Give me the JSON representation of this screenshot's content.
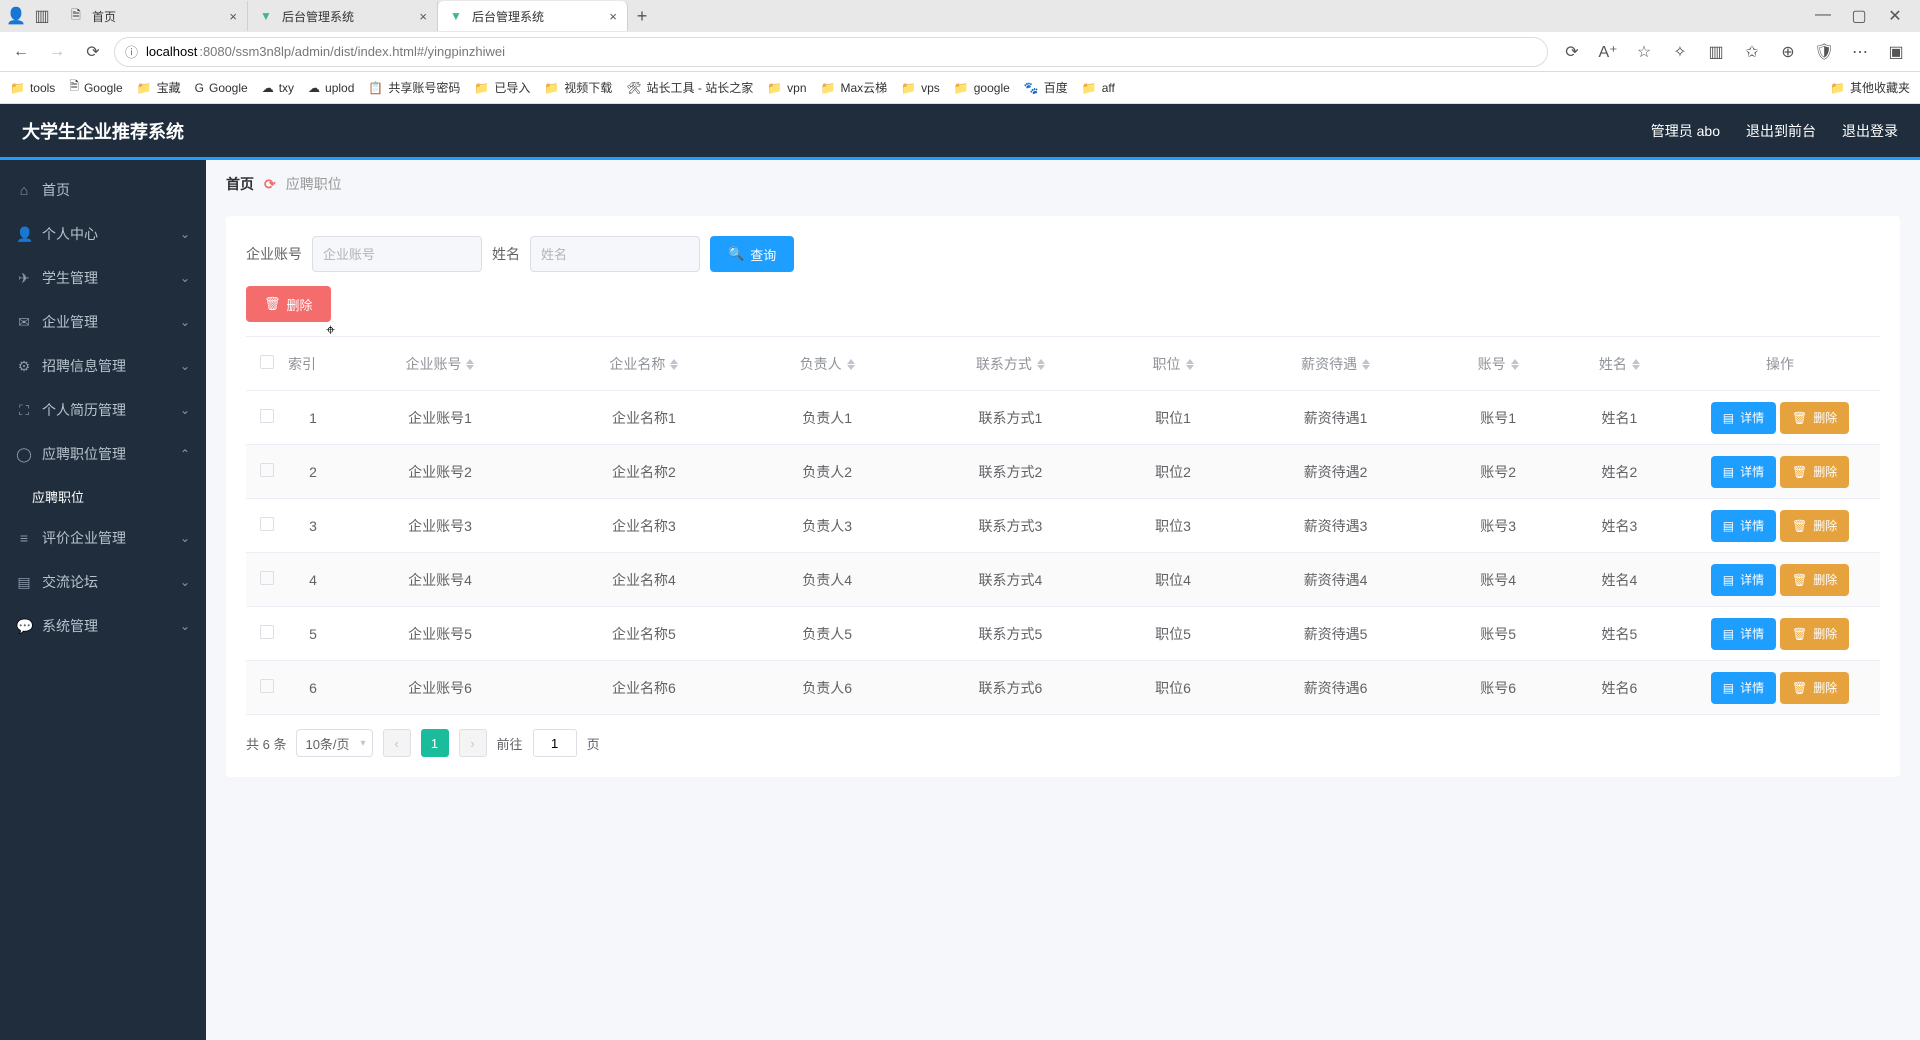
{
  "browser": {
    "tabs": [
      {
        "title": "首页"
      },
      {
        "title": "后台管理系统"
      },
      {
        "title": "后台管理系统"
      }
    ],
    "url_host": "localhost",
    "url_rest": ":8080/ssm3n8lp/admin/dist/index.html#/yingpinzhiwei",
    "bookmarks": [
      "tools",
      "Google",
      "宝藏",
      "Google",
      "txy",
      "uplod",
      "共享账号密码",
      "已导入",
      "视频下载",
      "站长工具 - 站长之家",
      "vpn",
      "Max云梯",
      "vps",
      "google",
      "百度",
      "aff"
    ],
    "other_bookmarks": "其他收藏夹"
  },
  "header": {
    "title": "大学生企业推荐系统",
    "admin_label": "管理员 abo",
    "front_label": "退出到前台",
    "logout_label": "退出登录"
  },
  "sidebar": {
    "items": [
      {
        "label": "首页",
        "icon": "home"
      },
      {
        "label": "个人中心",
        "icon": "user",
        "expandable": true
      },
      {
        "label": "学生管理",
        "icon": "plane",
        "expandable": true
      },
      {
        "label": "企业管理",
        "icon": "mail",
        "expandable": true
      },
      {
        "label": "招聘信息管理",
        "icon": "gear",
        "expandable": true
      },
      {
        "label": "个人简历管理",
        "icon": "expand",
        "expandable": true
      },
      {
        "label": "应聘职位管理",
        "icon": "circle",
        "expandable": true,
        "open": true
      },
      {
        "label": "评价企业管理",
        "icon": "bars",
        "expandable": true
      },
      {
        "label": "交流论坛",
        "icon": "chart",
        "expandable": true
      },
      {
        "label": "系统管理",
        "icon": "chat",
        "expandable": true
      }
    ],
    "submenu_active": "应聘职位"
  },
  "breadcrumb": {
    "home": "首页",
    "current": "应聘职位"
  },
  "filters": {
    "label1": "企业账号",
    "placeholder1": "企业账号",
    "label2": "姓名",
    "placeholder2": "姓名",
    "search_label": "查询",
    "delete_label": "删除"
  },
  "table": {
    "headers": [
      "索引",
      "企业账号",
      "企业名称",
      "负责人",
      "联系方式",
      "职位",
      "薪资待遇",
      "账号",
      "姓名",
      "操作"
    ],
    "action_detail": "详情",
    "action_delete": "删除",
    "rows": [
      {
        "idx": "1",
        "c1": "企业账号1",
        "c2": "企业名称1",
        "c3": "负责人1",
        "c4": "联系方式1",
        "c5": "职位1",
        "c6": "薪资待遇1",
        "c7": "账号1",
        "c8": "姓名1"
      },
      {
        "idx": "2",
        "c1": "企业账号2",
        "c2": "企业名称2",
        "c3": "负责人2",
        "c4": "联系方式2",
        "c5": "职位2",
        "c6": "薪资待遇2",
        "c7": "账号2",
        "c8": "姓名2"
      },
      {
        "idx": "3",
        "c1": "企业账号3",
        "c2": "企业名称3",
        "c3": "负责人3",
        "c4": "联系方式3",
        "c5": "职位3",
        "c6": "薪资待遇3",
        "c7": "账号3",
        "c8": "姓名3"
      },
      {
        "idx": "4",
        "c1": "企业账号4",
        "c2": "企业名称4",
        "c3": "负责人4",
        "c4": "联系方式4",
        "c5": "职位4",
        "c6": "薪资待遇4",
        "c7": "账号4",
        "c8": "姓名4"
      },
      {
        "idx": "5",
        "c1": "企业账号5",
        "c2": "企业名称5",
        "c3": "负责人5",
        "c4": "联系方式5",
        "c5": "职位5",
        "c6": "薪资待遇5",
        "c7": "账号5",
        "c8": "姓名5"
      },
      {
        "idx": "6",
        "c1": "企业账号6",
        "c2": "企业名称6",
        "c3": "负责人6",
        "c4": "联系方式6",
        "c5": "职位6",
        "c6": "薪资待遇6",
        "c7": "账号6",
        "c8": "姓名6"
      }
    ]
  },
  "pagination": {
    "total_label": "共 6 条",
    "page_size": "10条/页",
    "current": "1",
    "goto_prefix": "前往",
    "goto_value": "1",
    "goto_suffix": "页"
  }
}
